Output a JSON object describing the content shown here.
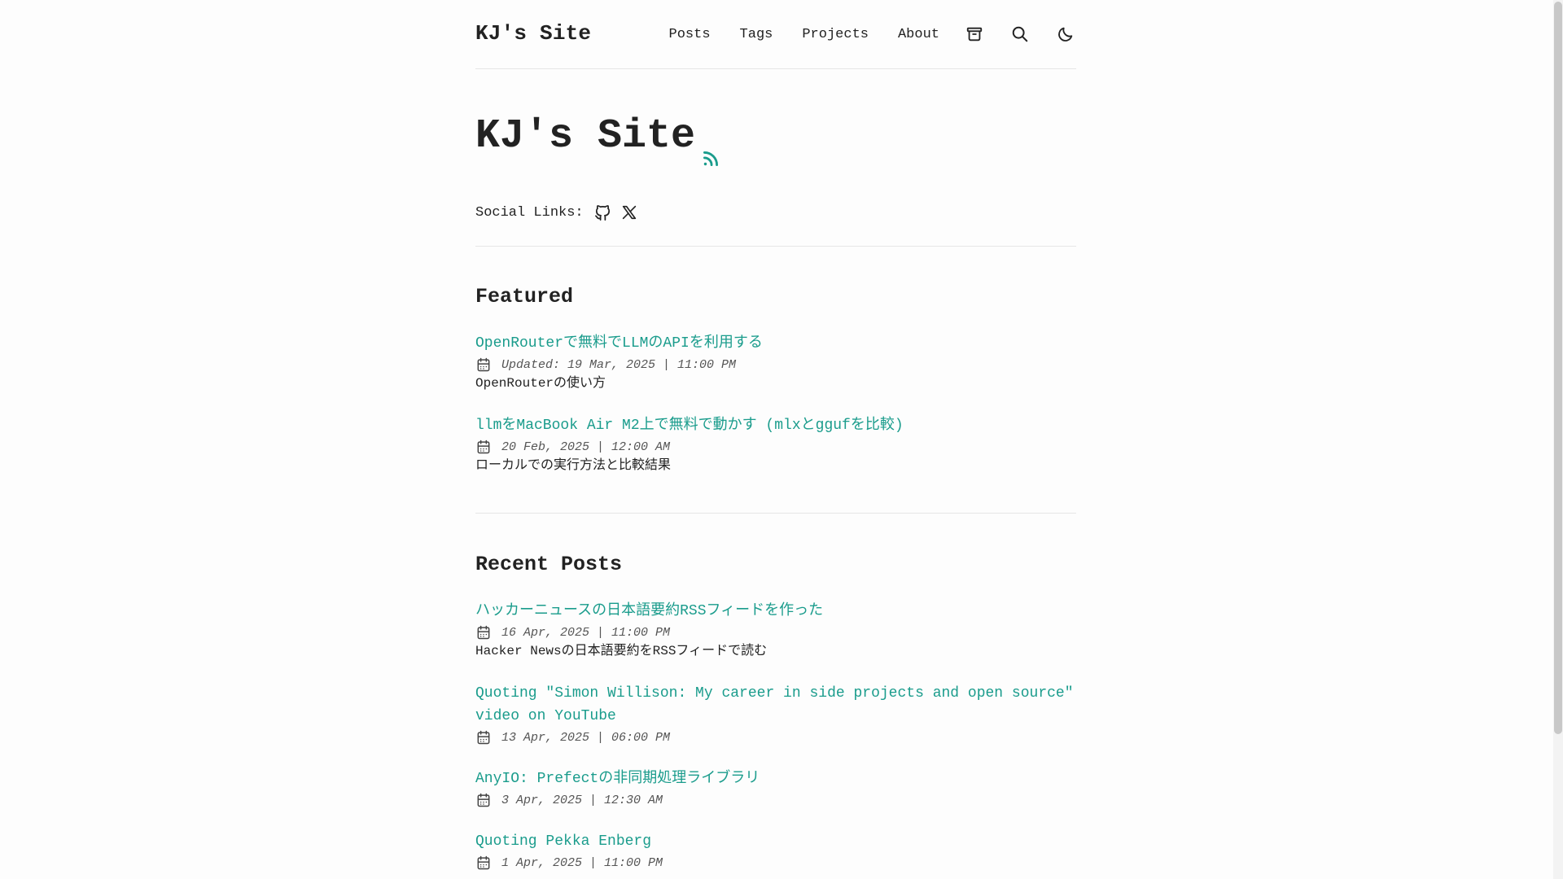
{
  "header": {
    "logo": "KJ's Site",
    "nav": [
      "Posts",
      "Tags",
      "Projects",
      "About"
    ],
    "icons": [
      "archive-icon",
      "search-icon",
      "moon-icon"
    ]
  },
  "hero": {
    "title": "KJ's Site",
    "social_label": "Social Links:",
    "social_icons": [
      "github-icon",
      "x-icon"
    ]
  },
  "featured": {
    "heading": "Featured",
    "posts": [
      {
        "title": "OpenRouterで無料でLLMのAPIを利用する",
        "date": "Updated: 19 Mar, 2025 | 11:00 PM",
        "desc": "OpenRouterの使い方"
      },
      {
        "title": "llmをMacBook Air M2上で無料で動かす (mlxとggufを比較)",
        "date": "20 Feb, 2025 | 12:00 AM",
        "desc": "ローカルでの実行方法と比較結果"
      }
    ]
  },
  "recent": {
    "heading": "Recent Posts",
    "posts": [
      {
        "title": "ハッカーニュースの日本語要約RSSフィードを作った",
        "date": "16 Apr, 2025 | 11:00 PM",
        "desc": "Hacker Newsの日本語要約をRSSフィードで読む"
      },
      {
        "title_line1": "Quoting \"Simon Willison: My career in side projects and open source\"",
        "title_line2": "video on YouTube",
        "date": "13 Apr, 2025 | 06:00 PM"
      },
      {
        "title": "AnyIO: Prefectの非同期処理ライブラリ",
        "date": "3 Apr, 2025 | 12:30 AM"
      },
      {
        "title": "Quoting Pekka Enberg",
        "date": "1 Apr, 2025 | 11:00 PM"
      }
    ]
  },
  "colors": {
    "accent": "#1a9c8c",
    "text": "#222222",
    "background": "#fdfdfd"
  }
}
